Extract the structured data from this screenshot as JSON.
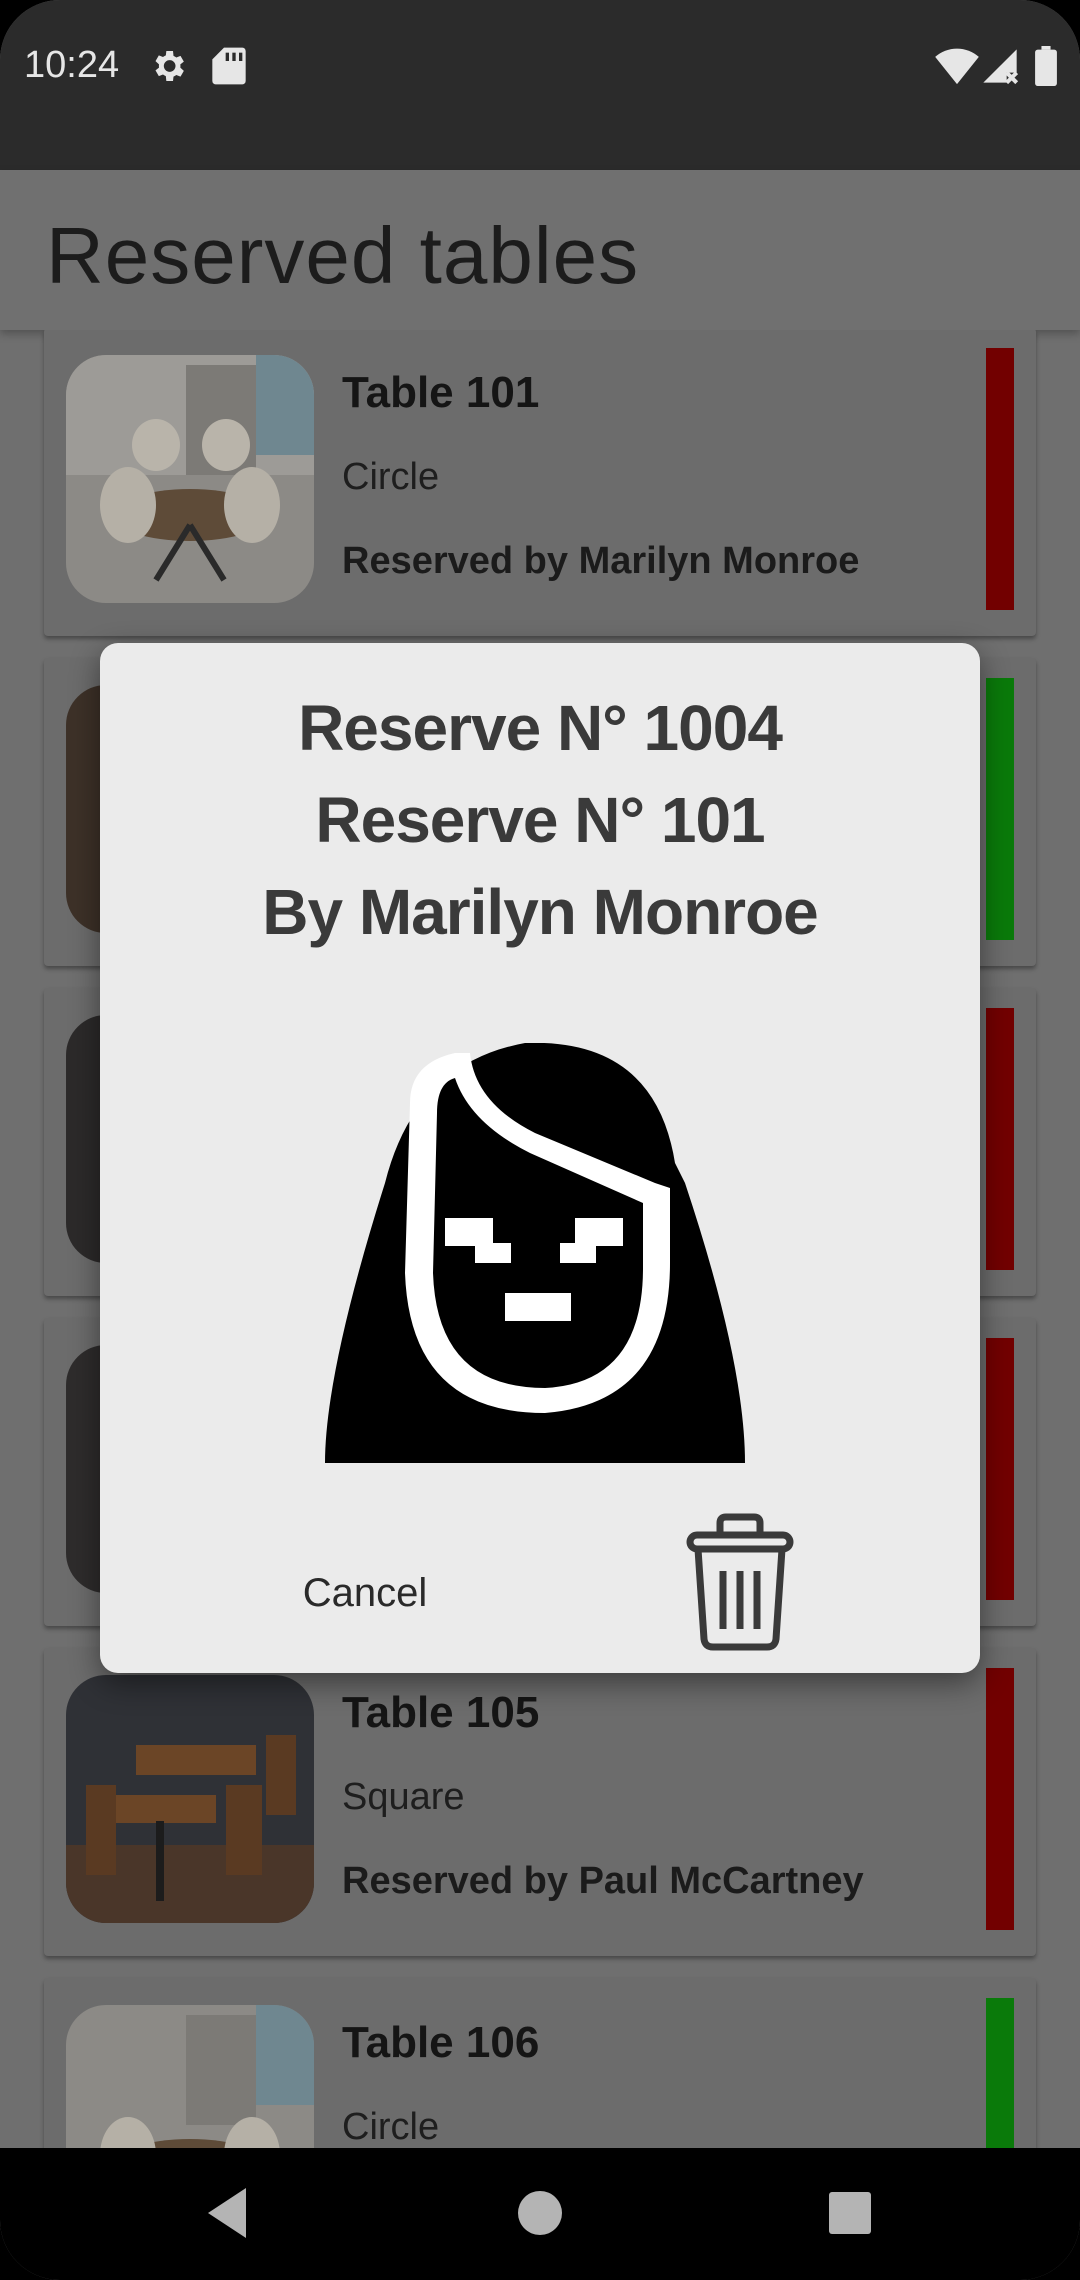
{
  "status_bar": {
    "time": "10:24",
    "icons": [
      "settings-icon",
      "sd-card-icon",
      "wifi-icon",
      "signal-icon",
      "battery-icon"
    ]
  },
  "app_bar": {
    "title": "Reserved tables"
  },
  "tables": [
    {
      "title": "Table 101",
      "shape": "Circle",
      "reserved": "Reserved by Marilyn Monroe",
      "status_color": "red"
    },
    {
      "title": "",
      "shape": "",
      "reserved": "",
      "status_color": "green"
    },
    {
      "title": "",
      "shape": "",
      "reserved": "",
      "status_color": "red"
    },
    {
      "title": "",
      "shape": "",
      "reserved": "",
      "status_color": "red"
    },
    {
      "title": "Table 105",
      "shape": "Square",
      "reserved": "Reserved by Paul McCartney",
      "status_color": "red"
    },
    {
      "title": "Table 106",
      "shape": "Circle",
      "reserved": "",
      "status_color": "green"
    }
  ],
  "dialog": {
    "line1": "Reserve N° 1004",
    "line2": "Reserve N° 101",
    "line3": "By Marilyn Monroe",
    "avatar_icon": "woman-avatar-icon",
    "cancel_label": "Cancel",
    "delete_icon": "trash-icon"
  },
  "nav_bar": {
    "buttons": [
      "back-icon",
      "home-icon",
      "recents-icon"
    ]
  },
  "colors": {
    "status_bar": "#2b2b2b",
    "scrim": "#6f6f6f",
    "dialog": "#ebebeb",
    "red": "#720000",
    "green": "#0a7a0a"
  }
}
